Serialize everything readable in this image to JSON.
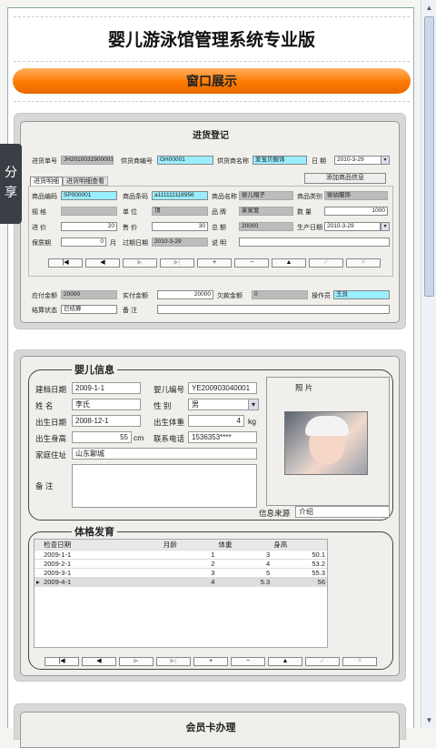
{
  "app_title": "婴儿游泳馆管理系统专业版",
  "banner": "窗口展示",
  "share": "分享",
  "purchase": {
    "title": "进货登记",
    "order_no_label": "进货单号",
    "order_no": "JH2010032900001",
    "supplier_no_label": "供货商编号",
    "supplier_no": "GH00001",
    "supplier_name_label": "供货商名称",
    "supplier_name": "爱宝贝服饰",
    "date_label": "日  期",
    "date": "2010-3-29",
    "tab1": "进货明细",
    "tab2": "进货明细查看",
    "add_btn": "添加商品信息",
    "code_label": "商品编码",
    "code": "SP000001",
    "barcode_label": "商品条码",
    "barcode": "a111111118956",
    "name_label": "商品名称",
    "name": "婴儿帽子",
    "category_label": "商品类别",
    "category": "婴幼服饰",
    "spec_label": "规    格",
    "unit_label": "单    位",
    "unit": "顶",
    "brand_label": "品    牌",
    "brand": "家家爱",
    "qty_label": "数    量",
    "qty": "1000",
    "cost_label": "进    价",
    "cost": "20",
    "price_label": "售    价",
    "price": "30",
    "total_label": "总    额",
    "total": "20000",
    "mfg_label": "生产日期",
    "mfg": "2010-3-29",
    "shelf_label": "保质期",
    "shelf": "0",
    "shelf_unit": "月",
    "expire_label": "过期日期",
    "expire": "2010-3-29",
    "note_label": "说    明",
    "nav": [
      "|◀",
      "◀",
      "▶",
      "▶|",
      "+",
      "−",
      "▲",
      "✓",
      "✕"
    ],
    "payable_label": "应付金额",
    "payable": "20000",
    "paid_label": "实付金额",
    "paid": "20000",
    "debt_label": "欠款金额",
    "debt": "0",
    "operator_label": "操作员",
    "operator": "王良",
    "status_label": "结算状态",
    "status": "已结算",
    "remark_label": "备    注"
  },
  "baby": {
    "section": "婴儿信息",
    "file_date_label": "建档日期",
    "file_date": "2009-1-1",
    "baby_no_label": "婴儿编号",
    "baby_no": "YE200903040001",
    "photo_label": "照        片",
    "name_label": "姓    名",
    "name": "李氏",
    "gender_label": "性    别",
    "gender": "男",
    "birth_label": "出生日期",
    "birth": "2008-12-1",
    "weight_label": "出生体重",
    "weight": "4",
    "weight_unit": "kg",
    "height_label": "出生身高",
    "height": "55",
    "height_unit": "cm",
    "phone_label": "联系电话",
    "phone": "1536353****",
    "address_label": "家庭住址",
    "address": "山东聊城",
    "remark_label": "备    注",
    "source_label": "信息来源",
    "source": "介绍",
    "growth_section": "体格发育",
    "columns": [
      "检查日期",
      "月龄",
      "体重",
      "身高"
    ],
    "rows": [
      {
        "date": "2009-1-1",
        "month": "1",
        "weight": "3",
        "height": "50.1"
      },
      {
        "date": "2009-2-1",
        "month": "2",
        "weight": "4",
        "height": "53.2"
      },
      {
        "date": "2009-3-1",
        "month": "3",
        "weight": "5",
        "height": "55.3"
      },
      {
        "date": "2009-4-1",
        "month": "4",
        "weight": "5.3",
        "height": "56"
      }
    ],
    "nav": [
      "|◀",
      "◀",
      "▶",
      "▶|",
      "+",
      "−",
      "▲",
      "✓",
      "✕"
    ]
  },
  "member": {
    "title": "会员卡办理"
  }
}
